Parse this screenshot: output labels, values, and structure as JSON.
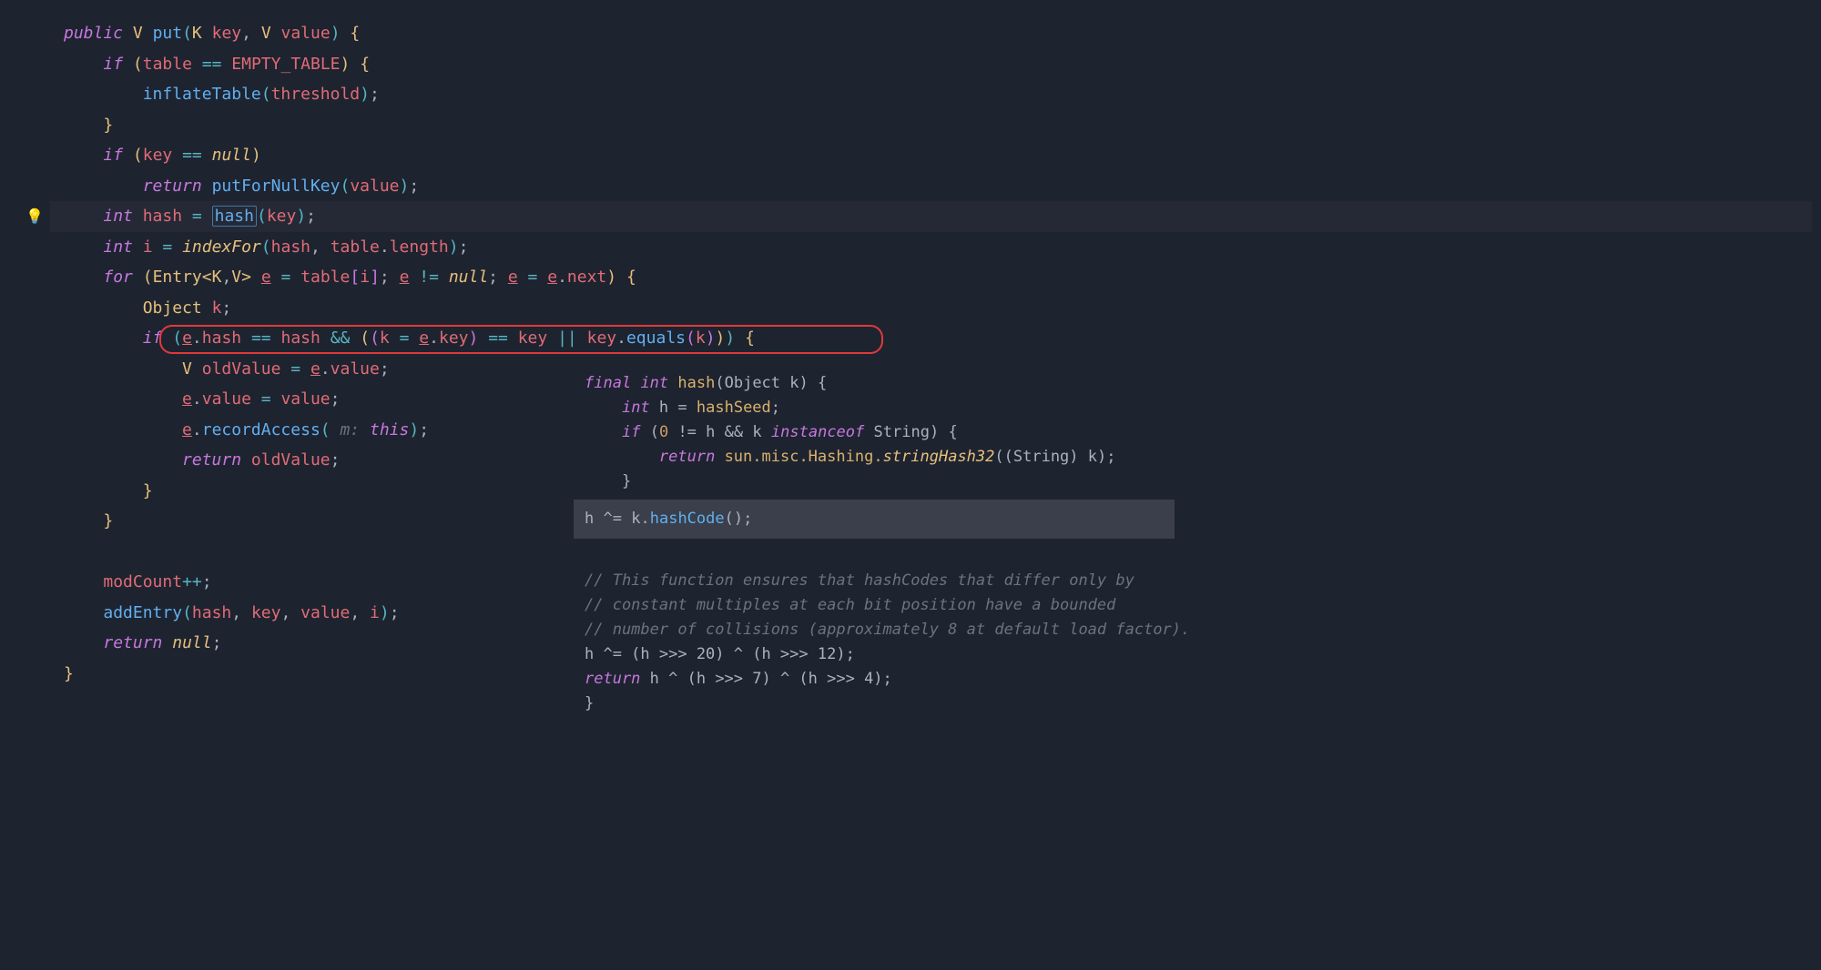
{
  "code": {
    "public": "public",
    "V": "V",
    "put": "put",
    "K": "K",
    "key": "key",
    "value": "value",
    "if": "if",
    "table": "table",
    "eqeq": "==",
    "EMPTY_TABLE": "EMPTY_TABLE",
    "inflateTable": "inflateTable",
    "threshold": "threshold",
    "null": "null",
    "return": "return",
    "putForNullKey": "putForNullKey",
    "int": "int",
    "hash_var": "hash",
    "hash_fn": "hash",
    "i": "i",
    "indexFor": "indexFor",
    "length": "length",
    "for": "for",
    "Entry": "Entry",
    "e": "e",
    "neq": "!=",
    "next": "next",
    "Object": "Object",
    "k": "k",
    "andand": "&&",
    "oror": "||",
    "equals": "equals",
    "oldValue": "oldValue",
    "recordAccess": "recordAccess",
    "m_hint": "m:",
    "this": "this",
    "modCount": "modCount",
    "plusplus": "++",
    "addEntry": "addEntry"
  },
  "popup": {
    "final": "final",
    "int": "int",
    "hash": "hash",
    "Object": "Object",
    "k": "k",
    "h": "h",
    "hashSeed": "hashSeed",
    "if": "if",
    "zero": "0",
    "neq": "!=",
    "andand": "&&",
    "instanceof": "instanceof",
    "String": "String",
    "return": "return",
    "sun_misc_Hashing": "sun.misc.Hashing.",
    "stringHash32": "stringHash32",
    "cast_String": "(String)",
    "xor_eq": "^=",
    "hashCode": "hashCode",
    "c1": "// This function ensures that hashCodes that differ only by",
    "c2": "// constant multiples at each bit position have a bounded",
    "c3": "// number of collisions (approximately 8 at default load factor).",
    "shift20": "h ^= (h >>> 20) ^ (h >>> 12);",
    "retexpr": "h ^ (h >>> 7) ^ (h >>> 4);"
  }
}
